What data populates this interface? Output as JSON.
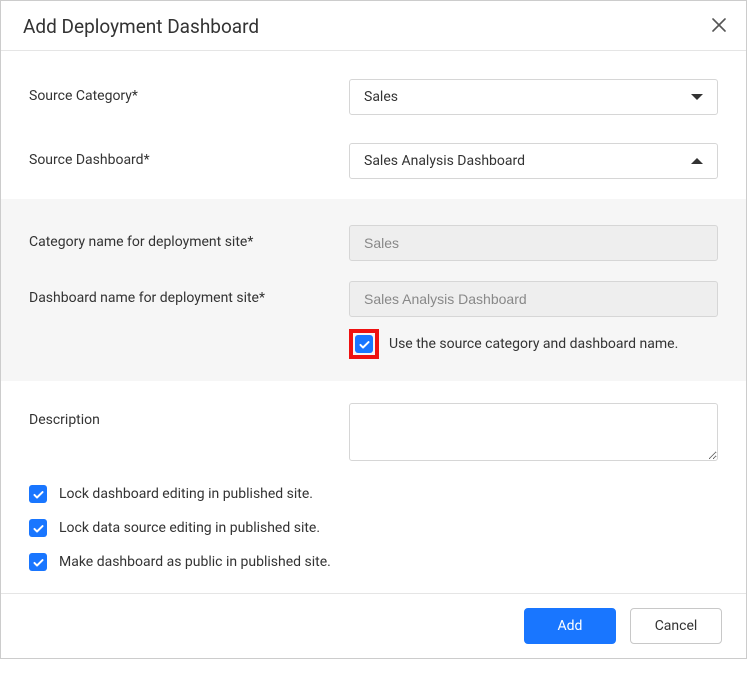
{
  "dialog": {
    "title": "Add Deployment Dashboard"
  },
  "form": {
    "sourceCategory": {
      "label": "Source Category*",
      "value": "Sales"
    },
    "sourceDashboard": {
      "label": "Source Dashboard*",
      "value": "Sales Analysis Dashboard"
    },
    "deployCategory": {
      "label": "Category name for deployment site*",
      "placeholder": "Sales"
    },
    "deployDashboard": {
      "label": "Dashboard name for deployment site*",
      "placeholder": "Sales Analysis Dashboard"
    },
    "useSourceNames": {
      "label": "Use the source category and dashboard name.",
      "checked": true
    },
    "description": {
      "label": "Description",
      "value": ""
    }
  },
  "options": {
    "lockDashboard": {
      "label": "Lock dashboard editing in published site.",
      "checked": true
    },
    "lockDataSource": {
      "label": "Lock data source editing in published site.",
      "checked": true
    },
    "makePublic": {
      "label": "Make dashboard as public in published site.",
      "checked": true
    }
  },
  "footer": {
    "add": "Add",
    "cancel": "Cancel"
  }
}
